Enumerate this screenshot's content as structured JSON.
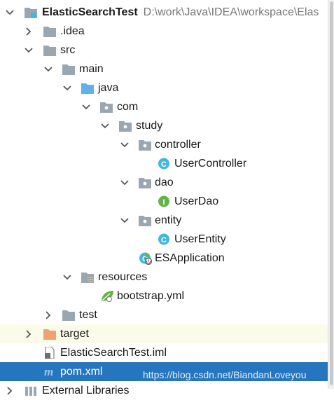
{
  "project": {
    "name": "ElasticSearchTest",
    "path": "D:\\work\\Java\\IDEA\\workspace\\Elas"
  },
  "tree": {
    "idea": ".idea",
    "src": "src",
    "main": "main",
    "java": "java",
    "com": "com",
    "study": "study",
    "controller": "controller",
    "user_controller": "UserController",
    "dao": "dao",
    "user_dao": "UserDao",
    "entity": "entity",
    "user_entity": "UserEntity",
    "es_application": "ESApplication",
    "resources": "resources",
    "bootstrap_yml": "bootstrap.yml",
    "test": "test",
    "target": "target",
    "iml_file": "ElasticSearchTest.iml",
    "pom_xml": "pom.xml",
    "external_libraries": "External Libraries"
  },
  "icon_letters": {
    "class": "C",
    "interface": "I"
  },
  "watermark": "https://blog.csdn.net/BiandanLoveyou",
  "colors": {
    "folder": "#9aa7b0",
    "source_folder": "#62b1e6",
    "excluded_folder": "#f0a270",
    "class_icon": "#40b6e0",
    "interface_icon": "#62b543",
    "selection": "#2675bf",
    "highlight_row": "#fbfbe9"
  }
}
